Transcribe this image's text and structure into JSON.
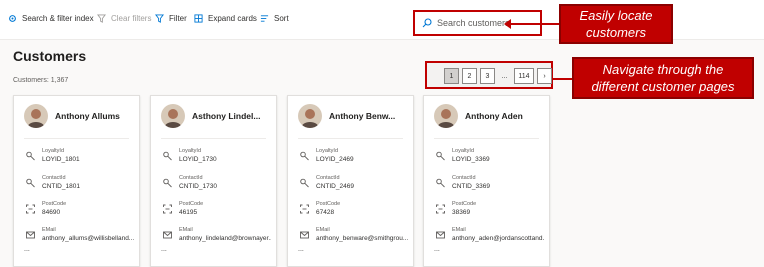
{
  "toolbar": {
    "index_label": "Search & filter index",
    "clear_label": "Clear filters",
    "filter_label": "Filter",
    "expand_label": "Expand cards",
    "sort_label": "Sort"
  },
  "search": {
    "placeholder": "Search customers"
  },
  "callouts": {
    "search_line1": "Easily locate",
    "search_line2": "customers",
    "pages_line1": "Navigate through the",
    "pages_line2": "different customer pages"
  },
  "header": {
    "title": "Customers",
    "count": "Customers: 1,367"
  },
  "pagination": {
    "pages": [
      "1",
      "2",
      "3"
    ],
    "ellipsis": "...",
    "last_page": "114",
    "next": "›",
    "current": "1"
  },
  "field_labels": {
    "loyalty": "LoyaltyId",
    "contact": "ContactId",
    "postcode": "PostCode",
    "email": "EMail",
    "more": "..."
  },
  "customers": [
    {
      "name": "Anthony Allums",
      "loyalty_id": "LOYID_1801",
      "contact_id": "CNTID_1801",
      "postcode": "84690",
      "email": "anthony_allums@willisbelland..."
    },
    {
      "name": "Asthony Lindel...",
      "loyalty_id": "LOYID_1730",
      "contact_id": "CNTID_1730",
      "postcode": "46195",
      "email": "anthony_lindeland@brownayer..."
    },
    {
      "name": "Anthony Benw...",
      "loyalty_id": "LOYID_2469",
      "contact_id": "CNTID_2469",
      "postcode": "67428",
      "email": "anthony_benware@smithgrou..."
    },
    {
      "name": "Anthony Aden",
      "loyalty_id": "LOYID_3369",
      "contact_id": "CNTID_3369",
      "postcode": "38369",
      "email": "anthony_aden@jordanscottand..."
    }
  ],
  "colors": {
    "accent": "#0078d4",
    "highlight": "#c00000"
  }
}
